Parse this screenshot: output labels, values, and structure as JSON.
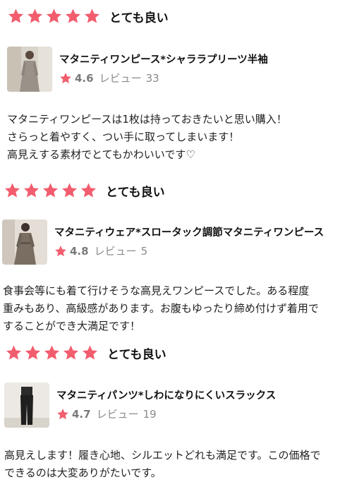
{
  "colors": {
    "star": "#f25d6e",
    "muted_text": "#8a8a8a"
  },
  "reviews": [
    {
      "stars": 5,
      "rating_label": "とても良い",
      "product": {
        "name": "マタニティワンピース*シャララプリーツ半袖",
        "average": "4.6",
        "review_label": "レビュー",
        "review_count": "33"
      },
      "text_lines": [
        "マタニティワンピースは1枚は持っておきたいと思い購入！",
        "さらっと着やすく、つい手に取ってしまいます！",
        "高見えする素材でとてもかわいいです♡"
      ]
    },
    {
      "stars": 5,
      "rating_label": "とても良い",
      "product": {
        "name": "マタニティウェア*スロータック調節マタニティワンピース",
        "average": "4.8",
        "review_label": "レビュー",
        "review_count": "5"
      },
      "text_lines": [
        "食事会等にも着て行けそうな高見えワンピースでした。ある程度",
        "重みもあり、高級感があります。お腹もゆったり締め付けず着用で",
        "することができ大満足です！"
      ]
    },
    {
      "stars": 5,
      "rating_label": "とても良い",
      "product": {
        "name": "マタニティパンツ*しわになりにくいスラックス",
        "average": "4.7",
        "review_label": "レビュー",
        "review_count": "19"
      },
      "text_lines": [
        "高見えします！履き心地、シルエットどれも満足です。この価格で",
        "できるのは大変ありがたいです。"
      ]
    }
  ]
}
